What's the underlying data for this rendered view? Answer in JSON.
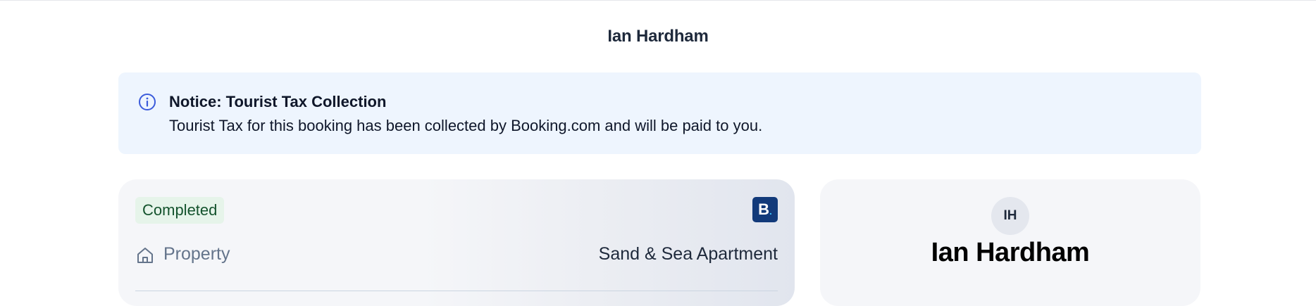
{
  "header": {
    "title": "Ian Hardham"
  },
  "notice": {
    "icon": "info-icon",
    "title": "Notice: Tourist Tax Collection",
    "message": "Tourist Tax for this booking has been collected by Booking.com and will be paid to you."
  },
  "booking": {
    "status": "Completed",
    "channel_logo": "B",
    "channel_logo_dot": ".",
    "property_icon": "home-icon",
    "property_label": "Property",
    "property_value": "Sand & Sea Apartment"
  },
  "guest": {
    "initials": "IH",
    "name": "Ian Hardham"
  },
  "colors": {
    "notice_bg": "#eef5fe",
    "info_accent": "#3b5bdb",
    "status_bg": "#e6f4ea",
    "status_text": "#14532d",
    "channel_brand": "#123a7a"
  }
}
